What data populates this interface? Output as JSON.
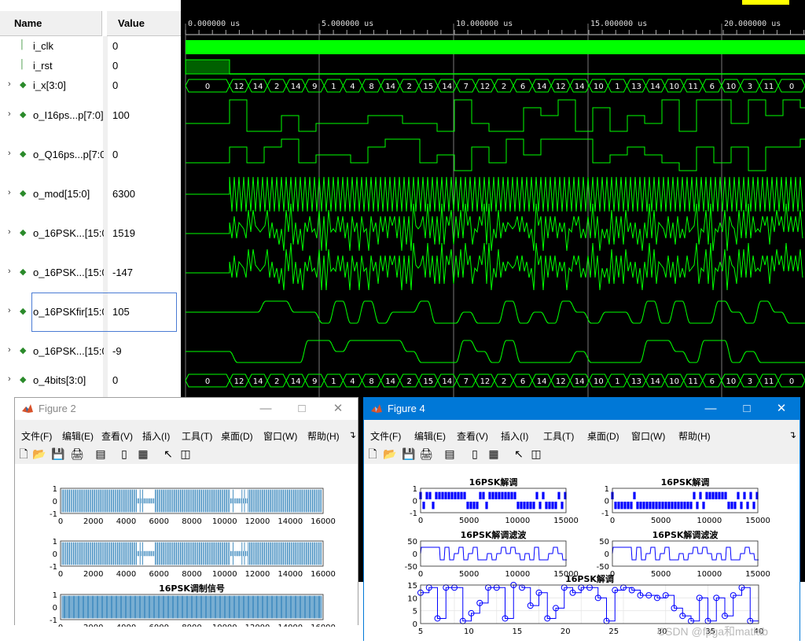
{
  "waveform": {
    "name_header": "Name",
    "value_header": "Value",
    "time_labels": [
      "0.000000 us",
      "5.000000 us",
      "10.000000 us",
      "15.000000 us",
      "20.000000 us"
    ],
    "signals": [
      {
        "name": "i_clk",
        "value": "0",
        "icon": "bit-signal-icon",
        "expandable": false
      },
      {
        "name": "i_rst",
        "value": "0",
        "icon": "bit-signal-icon",
        "expandable": false
      },
      {
        "name": "i_x[3:0]",
        "value": "0",
        "icon": "bus-signal-icon",
        "expandable": true
      },
      {
        "name": "o_I16ps...p[7:0]",
        "value": "100",
        "icon": "bus-signal-icon",
        "expandable": true
      },
      {
        "name": "o_Q16ps...p[7:0]",
        "value": "0",
        "icon": "bus-signal-icon",
        "expandable": true
      },
      {
        "name": "o_mod[15:0]",
        "value": "6300",
        "icon": "bus-signal-icon",
        "expandable": true
      },
      {
        "name": "o_16PSK...[15:0]",
        "value": "1519",
        "icon": "bus-signal-icon",
        "expandable": true
      },
      {
        "name": "o_16PSK...[15:0]",
        "value": "-147",
        "icon": "bus-signal-icon",
        "expandable": true
      },
      {
        "name": "o_16PSKfir[15:0]",
        "value": "105",
        "icon": "bus-signal-icon",
        "expandable": true
      },
      {
        "name": "o_16PSK...[15:0]",
        "value": "-9",
        "icon": "bus-signal-icon",
        "expandable": true
      },
      {
        "name": "o_4bits[3:0]",
        "value": "0",
        "icon": "bus-signal-icon",
        "expandable": true
      }
    ],
    "ix_bus_values": [
      "0",
      "12",
      "14",
      "2",
      "14",
      "9",
      "1",
      "4",
      "8",
      "14",
      "2",
      "15",
      "14",
      "7",
      "12",
      "2",
      "6",
      "14",
      "12",
      "14",
      "10",
      "1",
      "13",
      "14",
      "10",
      "11",
      "6",
      "10",
      "3",
      "11",
      "0"
    ],
    "o4bits_bus_values": [
      "0",
      "12",
      "14",
      "2",
      "14",
      "9",
      "1",
      "4",
      "8",
      "14",
      "2",
      "15",
      "14",
      "7",
      "12",
      "2",
      "6",
      "14",
      "12",
      "14",
      "10",
      "1",
      "13",
      "14",
      "10",
      "11",
      "6",
      "10",
      "3",
      "11",
      "0"
    ]
  },
  "figure2": {
    "title": "Figure 2",
    "menus": [
      "文件(F)",
      "编辑(E)",
      "查看(V)",
      "插入(I)",
      "工具(T)",
      "桌面(D)",
      "窗口(W)",
      "帮助(H)"
    ],
    "plots": [
      {
        "title": "",
        "yticks": [
          "1",
          "0",
          "-1"
        ],
        "xticks": [
          "0",
          "2000",
          "4000",
          "6000",
          "8000",
          "10000",
          "12000",
          "14000",
          "16000"
        ]
      },
      {
        "title": "",
        "yticks": [
          "1",
          "0",
          "-1"
        ],
        "xticks": [
          "0",
          "2000",
          "4000",
          "6000",
          "8000",
          "10000",
          "12000",
          "14000",
          "16000"
        ]
      },
      {
        "title": "16PSK调制信号",
        "yticks": [
          "1",
          "0",
          "-1"
        ],
        "xticks": [
          "0",
          "2000",
          "4000",
          "6000",
          "8000",
          "10000",
          "12000",
          "14000",
          "16000"
        ]
      }
    ]
  },
  "figure4": {
    "title": "Figure 4",
    "menus": [
      "文件(F)",
      "编辑(E)",
      "查看(V)",
      "插入(I)",
      "工具(T)",
      "桌面(D)",
      "窗口(W)",
      "帮助(H)"
    ],
    "plots": [
      {
        "title": "16PSK解调",
        "yticks": [
          "1",
          "0",
          "-1"
        ],
        "xticks": [
          "0",
          "5000",
          "10000",
          "15000"
        ]
      },
      {
        "title": "16PSK解调",
        "yticks": [
          "1",
          "0",
          "-1"
        ],
        "xticks": [
          "0",
          "5000",
          "10000",
          "15000"
        ]
      },
      {
        "title": "16PSK解调滤波",
        "yticks": [
          "50",
          "0",
          "-50"
        ],
        "xticks": [
          "0",
          "5000",
          "10000",
          "15000"
        ]
      },
      {
        "title": "16PSK解调滤波",
        "yticks": [
          "50",
          "0",
          "-50"
        ],
        "xticks": [
          "0",
          "5000",
          "10000",
          "15000"
        ]
      },
      {
        "title": "16PSK解调",
        "yticks": [
          "15",
          "10",
          "5",
          "0"
        ],
        "xticks": [
          "5",
          "10",
          "15",
          "20",
          "25",
          "30",
          "35",
          "40"
        ]
      }
    ]
  },
  "chart_data": [
    {
      "type": "line",
      "title": "16PSK解调",
      "x": [
        1,
        2,
        3,
        4,
        5,
        6,
        7,
        8,
        9,
        10,
        11,
        12,
        13,
        14,
        15,
        16,
        17,
        18,
        19,
        20,
        21,
        22,
        23,
        24,
        25,
        26,
        27,
        28,
        29,
        30,
        31,
        32,
        33,
        34,
        35,
        36,
        37,
        38,
        39,
        40
      ],
      "values": [
        12,
        14,
        2,
        14,
        14,
        1,
        4,
        8,
        14,
        14,
        2,
        15,
        14,
        7,
        12,
        2,
        6,
        14,
        12,
        14,
        14,
        10,
        1,
        13,
        14,
        13,
        11,
        11,
        10,
        11,
        6,
        3,
        1,
        10,
        1,
        10,
        3,
        11,
        14,
        1
      ],
      "xlim": [
        1,
        41
      ],
      "ylim": [
        0,
        15
      ],
      "grid": true
    }
  ],
  "colors": {
    "wave": "#00ff00",
    "wave_dark": "#00b000",
    "matlab_line": "#1f77b4",
    "demod_line": "#0000ff",
    "titlebar_active": "#0078d7"
  },
  "watermark": "CSDN @fpga和matlab"
}
